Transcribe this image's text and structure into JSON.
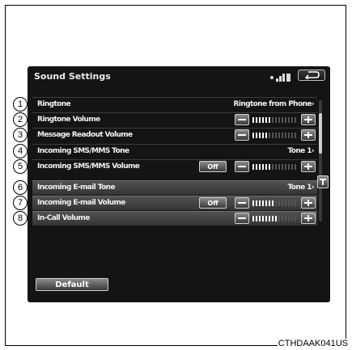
{
  "screen": {
    "title": "Sound Settings",
    "default_label": "Default"
  },
  "rows": [
    {
      "label": "Ringtone",
      "value": "Ringtone from Phone›",
      "level": null,
      "off": false,
      "highlight": false
    },
    {
      "label": "Ringtone Volume",
      "value": null,
      "level": 0.45,
      "off": false,
      "highlight": false
    },
    {
      "label": "Message Readout Volume",
      "value": null,
      "level": 0.35,
      "off": false,
      "highlight": false
    },
    {
      "label": "Incoming SMS/MMS Tone",
      "value": "Tone 1›",
      "level": null,
      "off": false,
      "highlight": false
    },
    {
      "label": "Incoming SMS/MMS Volume",
      "value": null,
      "level": 0.45,
      "off": true,
      "highlight": false
    },
    {
      "label": "Incoming E-mail Tone",
      "value": "Tone 1›",
      "level": null,
      "off": false,
      "highlight": true
    },
    {
      "label": "Incoming E-mail Volume",
      "value": null,
      "level": 0.5,
      "off": true,
      "highlight": true
    },
    {
      "label": "In-Call Volume",
      "value": null,
      "level": 0.6,
      "off": false,
      "highlight": true
    }
  ],
  "controls": {
    "off_label": "Off"
  },
  "callouts": [
    "1",
    "2",
    "3",
    "4",
    "5",
    "6",
    "7",
    "8"
  ],
  "caption": "CTHDAAK041US",
  "colors": {
    "screen_bg": "#141414",
    "level_on": "#ffffff",
    "level_off": "#555555"
  },
  "icons": {
    "back": "return-arrow-icon",
    "signal": "signal-bars-icon",
    "battery": "battery-icon"
  }
}
